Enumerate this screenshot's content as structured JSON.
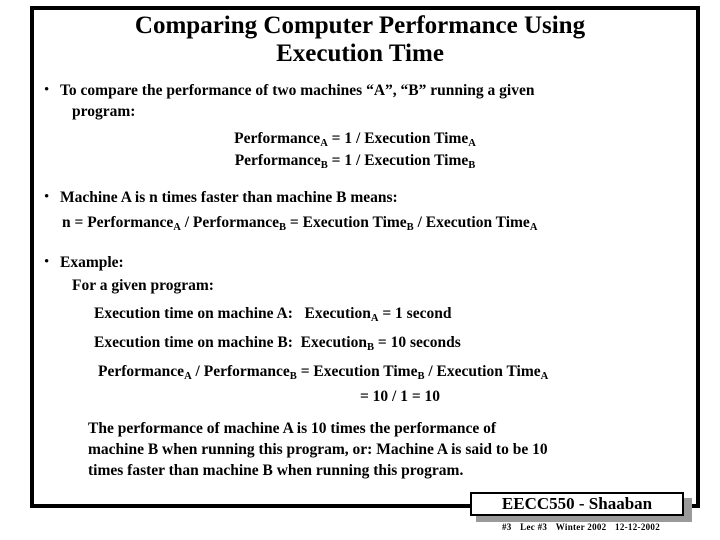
{
  "slide": {
    "title_line1": "Comparing Computer Performance Using",
    "title_line2": "Execution Time",
    "bullet_marker": "•",
    "bullets": [
      {
        "text": "To compare the performance of two machines “A”, “B” running a given",
        "continuation": "program:"
      },
      {
        "text": "Machine A is  n times faster than machine B means:"
      },
      {
        "text": "Example:",
        "continuation": "For a given program:"
      }
    ],
    "formulas": {
      "perf_a": {
        "lhs": "Performance",
        "lhs_sub": "A",
        "eq": "=",
        "one": "1  /",
        "rhs": "Execution Time",
        "rhs_sub": "A"
      },
      "perf_b": {
        "lhs": "Performance",
        "lhs_sub": "B",
        "eq": "=",
        "one": "1  /",
        "rhs": "Execution Time",
        "rhs_sub": "B"
      },
      "n_ratio": {
        "n": "n = Performance",
        "n_sub": "A",
        "over": "/  Performance",
        "over_sub": "B",
        "eq": "=  Execution Time",
        "eq_sub": "B",
        "tail": "/  Execution Time",
        "tail_sub": "A"
      },
      "example_a": {
        "label": "Execution time on machine A:",
        "expr": "Execution",
        "expr_sub": "A",
        "value": "=  1  second"
      },
      "example_b": {
        "label": "Execution time on machine B:",
        "expr": "Execution",
        "expr_sub": "B",
        "value": "=  10  seconds"
      },
      "example_ratio": {
        "lhs": "Performance",
        "lhs_sub": "A",
        "over": "/  Performance",
        "over_sub": "B",
        "eq": "=  Execution Time",
        "eq_sub": "B",
        "tail": "/  Execution Time",
        "tail_sub": "A"
      },
      "example_result": "=  10 / 1 = 10"
    },
    "conclusion": {
      "line1": "The performance of machine A  is 10 times the performance of",
      "line2": "machine B when running this program, or:  Machine A is said to be 10",
      "line3": "times faster than machine B when running this program."
    },
    "footer": {
      "label": "EECC550 - Shaaban",
      "slide_number": "#3",
      "lecture": "Lec #3",
      "term": "Winter 2002",
      "date": "12-12-2002"
    },
    "colors": {
      "text": "#000000",
      "background": "#ffffff",
      "border": "#000000",
      "shadow": "#9a9a9a"
    }
  }
}
